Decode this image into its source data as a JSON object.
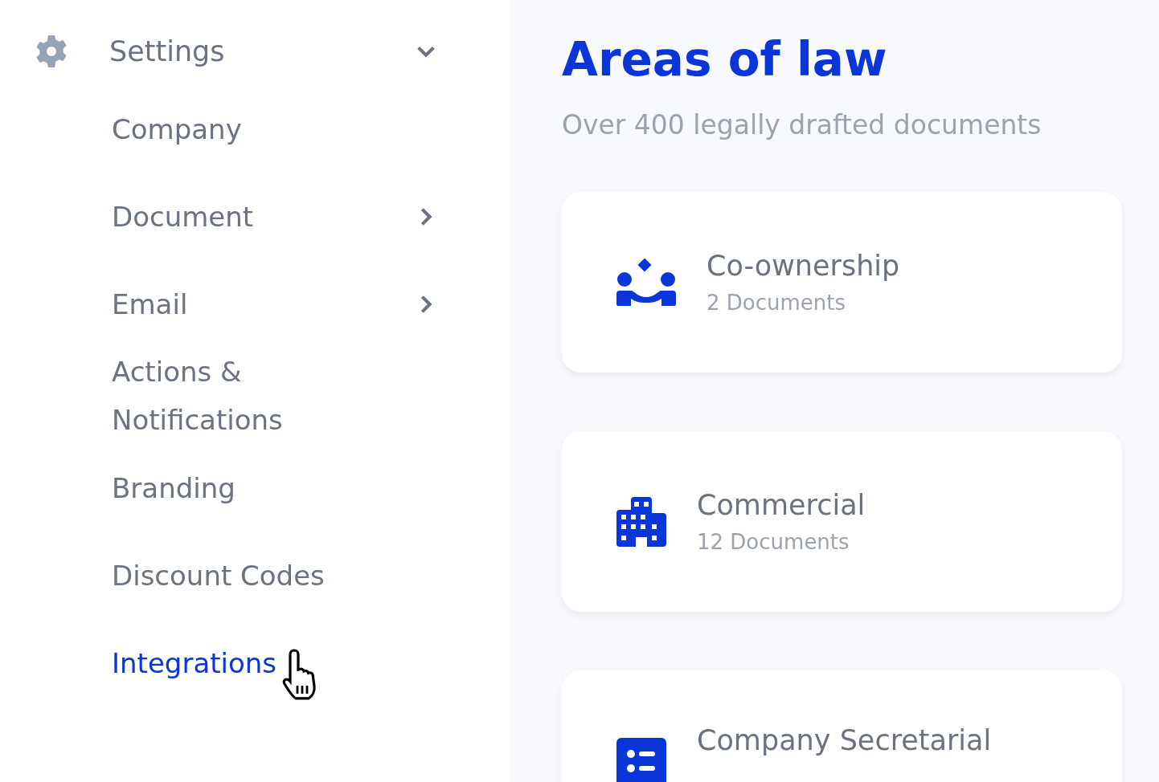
{
  "sidebar": {
    "section": {
      "label": "Settings",
      "expanded": true
    },
    "items": [
      {
        "label": "Company",
        "has_submenu": false,
        "selected": false,
        "hovered": false
      },
      {
        "label": "Document",
        "has_submenu": true,
        "selected": false,
        "hovered": false
      },
      {
        "label": "Email",
        "has_submenu": true,
        "selected": false,
        "hovered": false
      },
      {
        "label": "Actions & Notifications",
        "has_submenu": false,
        "selected": false,
        "hovered": false
      },
      {
        "label": "Branding",
        "has_submenu": false,
        "selected": false,
        "hovered": false
      },
      {
        "label": "Discount Codes",
        "has_submenu": false,
        "selected": false,
        "hovered": false
      },
      {
        "label": "Integrations",
        "has_submenu": false,
        "selected": true,
        "hovered": true
      }
    ]
  },
  "main": {
    "title": "Areas of law",
    "subtitle": "Over 400 legally drafted documents",
    "areas": [
      {
        "kind": "people",
        "name": "Co-ownership",
        "count": "2 Documents"
      },
      {
        "kind": "building",
        "name": "Commercial",
        "count": "12 Documents"
      },
      {
        "kind": "list",
        "name": "Company Secretarial"
      }
    ]
  }
}
